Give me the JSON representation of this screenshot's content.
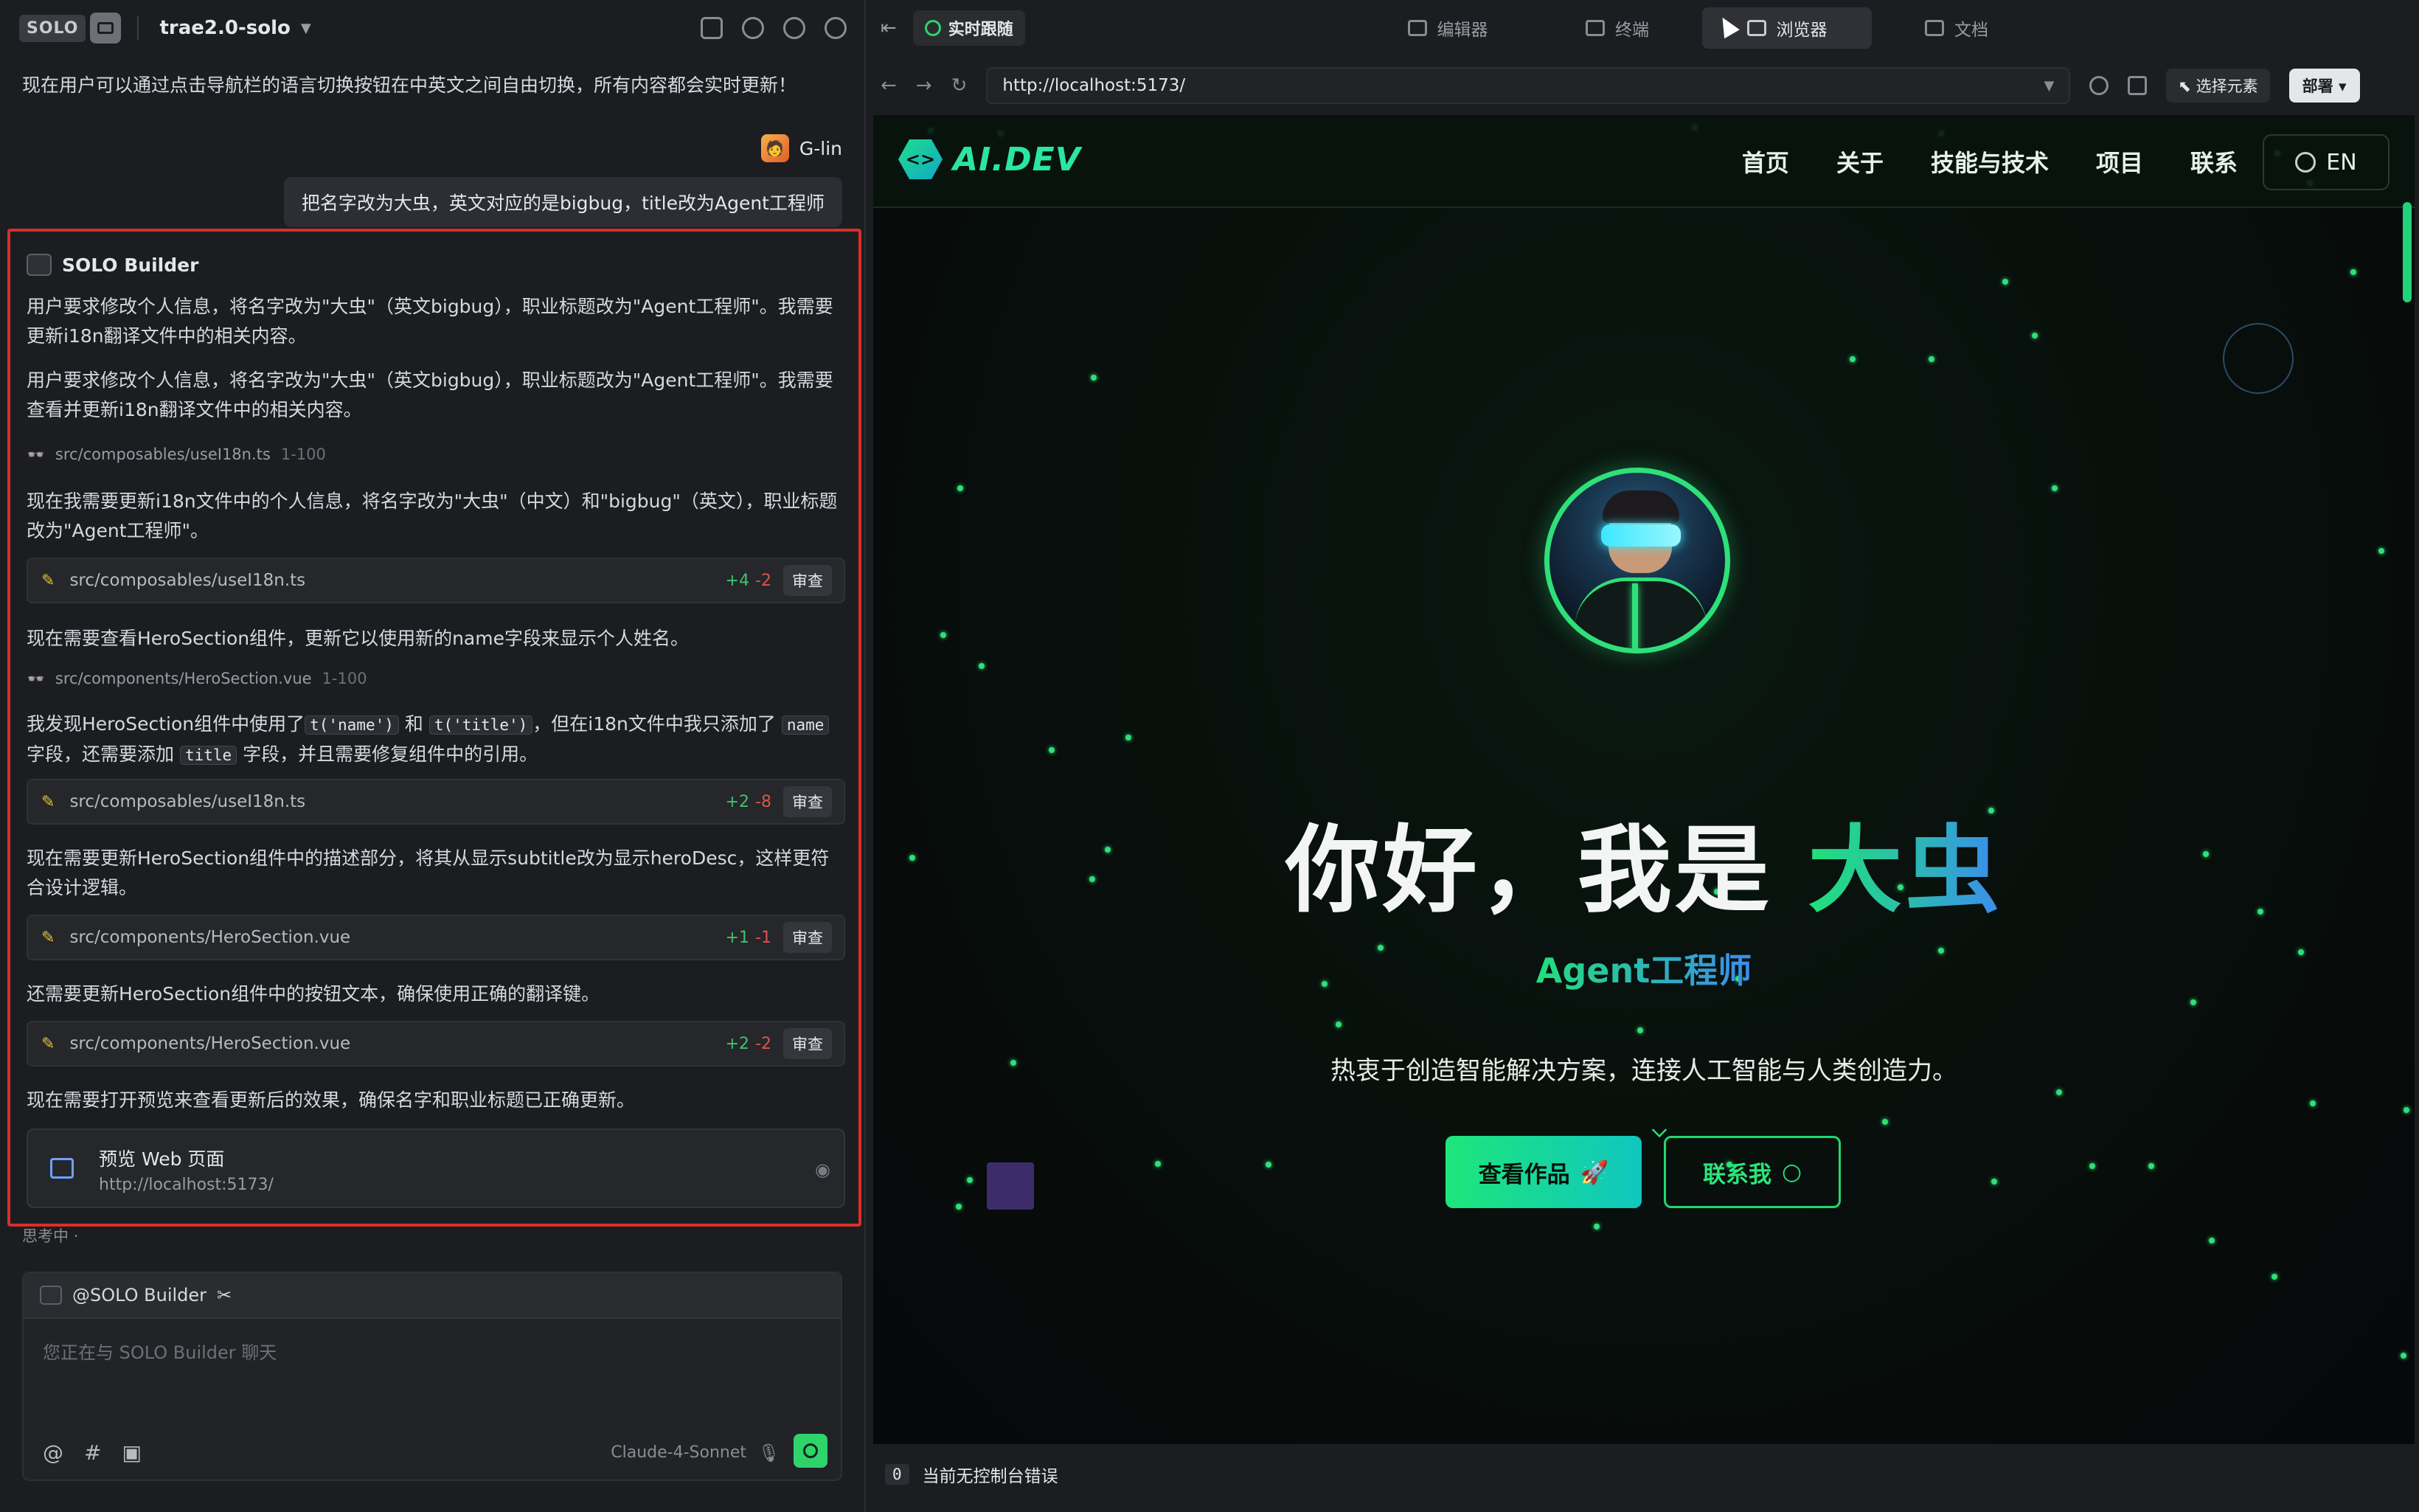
{
  "header": {
    "logo_text": "SOLO",
    "project_name": "trae2.0-solo"
  },
  "chat": {
    "assistant_msg": "现在用户可以通过点击导航栏的语言切换按钮在中英文之间自由切换，所有内容都会实时更新！",
    "user_name": "G-lin",
    "user_avatar": "🧑",
    "user_msg": "把名字改为大虫，英文对应的是bigbug，title改为Agent工程师"
  },
  "builder": {
    "title": "SOLO Builder",
    "p1": "用户要求修改个人信息，将名字改为\"大虫\"（英文bigbug），职业标题改为\"Agent工程师\"。我需要更新i18n翻译文件中的相关内容。",
    "p2": "用户要求修改个人信息，将名字改为\"大虫\"（英文bigbug），职业标题改为\"Agent工程师\"。我需要查看并更新i18n翻译文件中的相关内容。",
    "read1": {
      "file": "src/composables/useI18n.ts",
      "range": "1-100"
    },
    "p3": "现在我需要更新i18n文件中的个人信息，将名字改为\"大虫\"（中文）和\"bigbug\"（英文），职业标题改为\"Agent工程师\"。",
    "edit1": {
      "file": "src/composables/useI18n.ts",
      "add": "+4",
      "del": "-2"
    },
    "p4": "现在需要查看HeroSection组件，更新它以使用新的name字段来显示个人姓名。",
    "read2": {
      "file": "src/components/HeroSection.vue",
      "range": "1-100"
    },
    "p5_a": "我发现HeroSection组件中使用了",
    "p5_code1": "t('name')",
    "p5_b": "和",
    "p5_code2": "t('title')",
    "p5_c": "，但在i18n文件中我只添加了",
    "p5_code3": "name",
    "p5_d": "字段，还需要添加",
    "p5_code4": "title",
    "p5_e": "字段，并且需要修复组件中的引用。",
    "edit2": {
      "file": "src/composables/useI18n.ts",
      "add": "+2",
      "del": "-8"
    },
    "p6": "现在需要更新HeroSection组件中的描述部分，将其从显示subtitle改为显示heroDesc，这样更符合设计逻辑。",
    "edit3": {
      "file": "src/components/HeroSection.vue",
      "add": "+1",
      "del": "-1"
    },
    "p7": "还需要更新HeroSection组件中的按钮文本，确保使用正确的翻译键。",
    "edit4": {
      "file": "src/components/HeroSection.vue",
      "add": "+2",
      "del": "-2"
    },
    "p8": "现在需要打开预览来查看更新后的效果，确保名字和职业标题已正确更新。",
    "review_label": "审查",
    "preview_title": "预览 Web 页面",
    "preview_url": "http://localhost:5173/"
  },
  "thinking": "思考中  ·",
  "composer": {
    "mention": "@SOLO Builder",
    "placeholder": "您正在与 SOLO Builder 聊天",
    "model": "Claude-4-Sonnet"
  },
  "right": {
    "live_label": "实时跟随",
    "tabs": [
      "编辑器",
      "终端",
      "浏览器",
      "文档"
    ],
    "active_tab": "浏览器",
    "url": "http://localhost:5173/",
    "pick_label": "选择元素",
    "deploy_label": "部署",
    "console_count": "0",
    "console_msg": "当前无控制台错误"
  },
  "site": {
    "logo": "AI.DEV",
    "menu": [
      "首页",
      "关于",
      "技能与技术",
      "项目",
      "联系"
    ],
    "lang": "EN",
    "greeting": "你好，我是 ",
    "name": "大虫",
    "role": "Agent工程师",
    "desc": "热衷于创造智能解决方案，连接人工智能与人类创造力。",
    "btn_works": "查看作品",
    "btn_contact": "联系我"
  },
  "colors": {
    "accent_green": "#2fe07a",
    "highlight_border": "#d6302a",
    "diff_add": "#3cc46a",
    "diff_del": "#e2524a"
  }
}
